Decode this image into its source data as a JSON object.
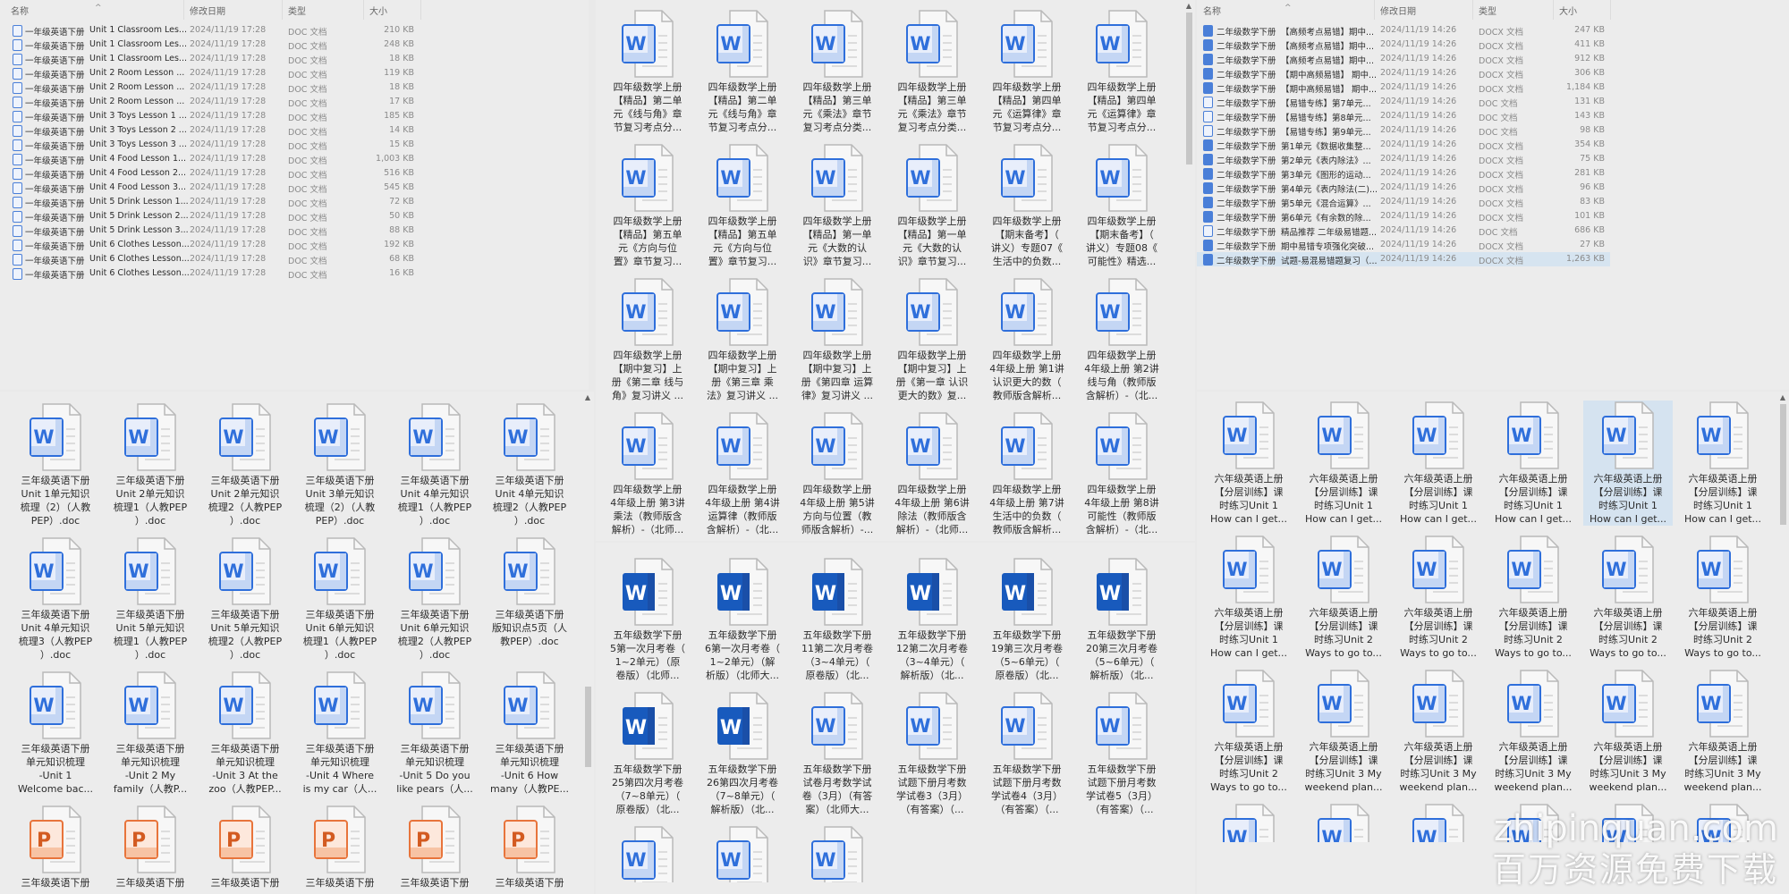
{
  "list_headers": {
    "name": "名称",
    "date": "修改日期",
    "type": "类型",
    "size": "大小"
  },
  "left_list": [
    {
      "prefix": "一年级英语下册",
      "name": "Unit 1 Classroom Les...",
      "date": "2024/11/19 17:28",
      "type": "DOC 文档",
      "size": "210 KB",
      "icon": "doc"
    },
    {
      "prefix": "一年级英语下册",
      "name": "Unit 1 Classroom Les...",
      "date": "2024/11/19 17:28",
      "type": "DOC 文档",
      "size": "248 KB",
      "icon": "doc"
    },
    {
      "prefix": "一年级英语下册",
      "name": "Unit 1 Classroom Les...",
      "date": "2024/11/19 17:28",
      "type": "DOC 文档",
      "size": "18 KB",
      "icon": "doc"
    },
    {
      "prefix": "一年级英语下册",
      "name": "Unit 2 Room Lesson ...",
      "date": "2024/11/19 17:28",
      "type": "DOC 文档",
      "size": "119 KB",
      "icon": "doc"
    },
    {
      "prefix": "一年级英语下册",
      "name": "Unit 2 Room Lesson ...",
      "date": "2024/11/19 17:28",
      "type": "DOC 文档",
      "size": "18 KB",
      "icon": "doc"
    },
    {
      "prefix": "一年级英语下册",
      "name": "Unit 2 Room Lesson ...",
      "date": "2024/11/19 17:28",
      "type": "DOC 文档",
      "size": "17 KB",
      "icon": "doc"
    },
    {
      "prefix": "一年级英语下册",
      "name": "Unit 3 Toys Lesson 1 ...",
      "date": "2024/11/19 17:28",
      "type": "DOC 文档",
      "size": "185 KB",
      "icon": "doc"
    },
    {
      "prefix": "一年级英语下册",
      "name": "Unit 3 Toys Lesson 2 ...",
      "date": "2024/11/19 17:28",
      "type": "DOC 文档",
      "size": "14 KB",
      "icon": "doc"
    },
    {
      "prefix": "一年级英语下册",
      "name": "Unit 3 Toys Lesson 3 ...",
      "date": "2024/11/19 17:28",
      "type": "DOC 文档",
      "size": "15 KB",
      "icon": "doc"
    },
    {
      "prefix": "一年级英语下册",
      "name": "Unit 4 Food Lesson 1...",
      "date": "2024/11/19 17:28",
      "type": "DOC 文档",
      "size": "1,003 KB",
      "icon": "doc"
    },
    {
      "prefix": "一年级英语下册",
      "name": "Unit 4 Food Lesson 2...",
      "date": "2024/11/19 17:28",
      "type": "DOC 文档",
      "size": "516 KB",
      "icon": "doc"
    },
    {
      "prefix": "一年级英语下册",
      "name": "Unit 4 Food Lesson 3...",
      "date": "2024/11/19 17:28",
      "type": "DOC 文档",
      "size": "545 KB",
      "icon": "doc"
    },
    {
      "prefix": "一年级英语下册",
      "name": "Unit 5 Drink Lesson 1...",
      "date": "2024/11/19 17:28",
      "type": "DOC 文档",
      "size": "72 KB",
      "icon": "doc"
    },
    {
      "prefix": "一年级英语下册",
      "name": "Unit 5 Drink Lesson 2...",
      "date": "2024/11/19 17:28",
      "type": "DOC 文档",
      "size": "50 KB",
      "icon": "doc"
    },
    {
      "prefix": "一年级英语下册",
      "name": "Unit 5 Drink Lesson 3...",
      "date": "2024/11/19 17:28",
      "type": "DOC 文档",
      "size": "88 KB",
      "icon": "doc"
    },
    {
      "prefix": "一年级英语下册",
      "name": "Unit 6 Clothes Lesson...",
      "date": "2024/11/19 17:28",
      "type": "DOC 文档",
      "size": "192 KB",
      "icon": "doc"
    },
    {
      "prefix": "一年级英语下册",
      "name": "Unit 6 Clothes Lesson...",
      "date": "2024/11/19 17:28",
      "type": "DOC 文档",
      "size": "68 KB",
      "icon": "doc"
    },
    {
      "prefix": "一年级英语下册",
      "name": "Unit 6 Clothes Lesson...",
      "date": "2024/11/19 17:28",
      "type": "DOC 文档",
      "size": "16 KB",
      "icon": "doc"
    }
  ],
  "right_list": [
    {
      "prefix": "二年级数学下册",
      "name": "【高频考点易错】期中...",
      "date": "2024/11/19 14:26",
      "type": "DOCX 文档",
      "size": "247 KB",
      "icon": "docx"
    },
    {
      "prefix": "二年级数学下册",
      "name": "【高频考点易错】期中...",
      "date": "2024/11/19 14:26",
      "type": "DOCX 文档",
      "size": "411 KB",
      "icon": "docx"
    },
    {
      "prefix": "二年级数学下册",
      "name": "【高频考点易错】期中...",
      "date": "2024/11/19 14:26",
      "type": "DOCX 文档",
      "size": "912 KB",
      "icon": "docx"
    },
    {
      "prefix": "二年级数学下册",
      "name": "【期中高频易错】 期中...",
      "date": "2024/11/19 14:26",
      "type": "DOCX 文档",
      "size": "306 KB",
      "icon": "docx"
    },
    {
      "prefix": "二年级数学下册",
      "name": "【期中高频易错】 期中...",
      "date": "2024/11/19 14:26",
      "type": "DOCX 文档",
      "size": "1,184 KB",
      "icon": "docx"
    },
    {
      "prefix": "二年级数学下册",
      "name": "【易错专练】第7单元...",
      "date": "2024/11/19 14:26",
      "type": "DOC 文档",
      "size": "131 KB",
      "icon": "doc"
    },
    {
      "prefix": "二年级数学下册",
      "name": "【易错专练】第8单元...",
      "date": "2024/11/19 14:26",
      "type": "DOC 文档",
      "size": "143 KB",
      "icon": "doc"
    },
    {
      "prefix": "二年级数学下册",
      "name": "【易错专练】第9单元...",
      "date": "2024/11/19 14:26",
      "type": "DOC 文档",
      "size": "98 KB",
      "icon": "doc"
    },
    {
      "prefix": "二年级数学下册",
      "name": "第1单元《数据收集整...",
      "date": "2024/11/19 14:26",
      "type": "DOCX 文档",
      "size": "354 KB",
      "icon": "docx"
    },
    {
      "prefix": "二年级数学下册",
      "name": "第2单元《表内除法》...",
      "date": "2024/11/19 14:26",
      "type": "DOCX 文档",
      "size": "75 KB",
      "icon": "docx"
    },
    {
      "prefix": "二年级数学下册",
      "name": "第3单元《图形的运动...",
      "date": "2024/11/19 14:26",
      "type": "DOCX 文档",
      "size": "281 KB",
      "icon": "docx"
    },
    {
      "prefix": "二年级数学下册",
      "name": "第4单元《表内除法(二)...",
      "date": "2024/11/19 14:26",
      "type": "DOCX 文档",
      "size": "96 KB",
      "icon": "docx"
    },
    {
      "prefix": "二年级数学下册",
      "name": "第5单元《混合运算》...",
      "date": "2024/11/19 14:26",
      "type": "DOCX 文档",
      "size": "83 KB",
      "icon": "docx"
    },
    {
      "prefix": "二年级数学下册",
      "name": "第6单元《有余数的除...",
      "date": "2024/11/19 14:26",
      "type": "DOCX 文档",
      "size": "101 KB",
      "icon": "docx"
    },
    {
      "prefix": "二年级数学下册",
      "name": "精品推荐 二年级易错题...",
      "date": "2024/11/19 14:26",
      "type": "DOC 文档",
      "size": "686 KB",
      "icon": "doc"
    },
    {
      "prefix": "二年级数学下册",
      "name": "期中易错专项强化突破...",
      "date": "2024/11/19 14:26",
      "type": "DOCX 文档",
      "size": "27 KB",
      "icon": "docx"
    },
    {
      "prefix": "二年级数学下册",
      "name": "试题-易混易错题复习（...",
      "date": "2024/11/19 14:26",
      "type": "DOCX 文档",
      "size": "1,263 KB",
      "icon": "docx",
      "selected": true
    }
  ],
  "left_grid": [
    {
      "icon": "word",
      "label": "三年级英语下册\nUnit 1单元知识\n梳理（2）（人教\nPEP）.doc"
    },
    {
      "icon": "word",
      "label": "三年级英语下册\nUnit 2单元知识\n梳理1（人教PEP\n）.doc"
    },
    {
      "icon": "word",
      "label": "三年级英语下册\nUnit 2单元知识\n梳理2（人教PEP\n）.doc"
    },
    {
      "icon": "word",
      "label": "三年级英语下册\nUnit 3单元知识\n梳理（2）（人教\nPEP）.doc"
    },
    {
      "icon": "word",
      "label": "三年级英语下册\nUnit 4单元知识\n梳理1（人教PEP\n）.doc"
    },
    {
      "icon": "word",
      "label": "三年级英语下册\nUnit 4单元知识\n梳理2（人教PEP\n）.doc"
    },
    {
      "icon": "word",
      "label": "三年级英语下册\nUnit 4单元知识\n梳理3（人教PEP\n）.doc"
    },
    {
      "icon": "word",
      "label": "三年级英语下册\nUnit 5单元知识\n梳理1（人教PEP\n）.doc"
    },
    {
      "icon": "word",
      "label": "三年级英语下册\nUnit 5单元知识\n梳理2（人教PEP\n）.doc"
    },
    {
      "icon": "word",
      "label": "三年级英语下册\nUnit 6单元知识\n梳理1（人教PEP\n）.doc"
    },
    {
      "icon": "word",
      "label": "三年级英语下册\nUnit 6单元知识\n梳理2（人教PEP\n）.doc"
    },
    {
      "icon": "word",
      "label": "三年级英语下册\n版知识点5页（人\n教PEP）.doc"
    },
    {
      "icon": "word",
      "label": "三年级英语下册\n单元知识梳理\n-Unit 1\nWelcome bac..."
    },
    {
      "icon": "word",
      "label": "三年级英语下册\n单元知识梳理\n-Unit 2 My\nfamily（人教P..."
    },
    {
      "icon": "word",
      "label": "三年级英语下册\n单元知识梳理\n-Unit 3 At the\nzoo（人教PEP..."
    },
    {
      "icon": "word",
      "label": "三年级英语下册\n单元知识梳理\n-Unit 4 Where\nis my car（人..."
    },
    {
      "icon": "word",
      "label": "三年级英语下册\n单元知识梳理\n-Unit 5 Do you\nlike pears（人..."
    },
    {
      "icon": "word",
      "label": "三年级英语下册\n单元知识梳理\n-Unit 6 How\nmany（人教PE..."
    },
    {
      "icon": "ppt",
      "label": "三年级英语下册"
    },
    {
      "icon": "ppt",
      "label": "三年级英语下册"
    },
    {
      "icon": "ppt",
      "label": "三年级英语下册"
    },
    {
      "icon": "ppt",
      "label": "三年级英语下册"
    },
    {
      "icon": "ppt",
      "label": "三年级英语下册"
    },
    {
      "icon": "ppt",
      "label": "三年级英语下册"
    }
  ],
  "middle_top_grid": [
    {
      "icon": "word",
      "label": "四年级数学上册\n【精品】第二单\n元《线与角》章\n节复习考点分..."
    },
    {
      "icon": "word",
      "label": "四年级数学上册\n【精品】第二单\n元《线与角》章\n节复习考点分..."
    },
    {
      "icon": "word",
      "label": "四年级数学上册\n【精品】第三单\n元《乘法》章节\n复习考点分类..."
    },
    {
      "icon": "word",
      "label": "四年级数学上册\n【精品】第三单\n元《乘法》章节\n复习考点分类..."
    },
    {
      "icon": "word",
      "label": "四年级数学上册\n【精品】第四单\n元《运算律》章\n节复习考点分..."
    },
    {
      "icon": "word",
      "label": "四年级数学上册\n【精品】第四单\n元《运算律》章\n节复习考点分..."
    },
    {
      "icon": "word",
      "label": "四年级数学上册\n【精品】第五单\n元《方向与位\n置》章节复习..."
    },
    {
      "icon": "word",
      "label": "四年级数学上册\n【精品】第五单\n元《方向与位\n置》章节复习..."
    },
    {
      "icon": "word",
      "label": "四年级数学上册\n【精品】第一单\n元《大数的认\n识》章节复习..."
    },
    {
      "icon": "word",
      "label": "四年级数学上册\n【精品】第一单\n元《大数的认\n识》章节复习..."
    },
    {
      "icon": "word",
      "label": "四年级数学上册\n【期末备考】（\n讲义）专题07《\n生活中的负数..."
    },
    {
      "icon": "word",
      "label": "四年级数学上册\n【期末备考】（\n讲义）专题08《\n可能性》精选..."
    },
    {
      "icon": "word",
      "label": "四年级数学上册\n【期中复习】上\n册《第二章 线与\n角》复习讲义 ..."
    },
    {
      "icon": "word",
      "label": "四年级数学上册\n【期中复习】上\n册《第三章 乘\n法》复习讲义 ..."
    },
    {
      "icon": "word",
      "label": "四年级数学上册\n【期中复习】上\n册《第四章 运算\n律》复习讲义 ..."
    },
    {
      "icon": "word",
      "label": "四年级数学上册\n【期中复习】上\n册《第一章 认识\n更大的数》复..."
    },
    {
      "icon": "word",
      "label": "四年级数学上册\n4年级上册 第1讲\n认识更大的数（\n教师版含解析..."
    },
    {
      "icon": "word",
      "label": "四年级数学上册\n4年级上册 第2讲\n线与角（教师版\n含解析）-（北..."
    },
    {
      "icon": "word",
      "label": "四年级数学上册\n4年级上册 第3讲\n乘法（教师版含\n解析）-（北师..."
    },
    {
      "icon": "word",
      "label": "四年级数学上册\n4年级上册 第4讲\n运算律（教师版\n含解析）-（北..."
    },
    {
      "icon": "word",
      "label": "四年级数学上册\n4年级上册 第5讲\n方向与位置（教\n师版含解析）-..."
    },
    {
      "icon": "word",
      "label": "四年级数学上册\n4年级上册 第6讲\n除法（教师版含\n解析）-（北师..."
    },
    {
      "icon": "word",
      "label": "四年级数学上册\n4年级上册 第7讲\n生活中的负数（\n教师版含解析..."
    },
    {
      "icon": "word",
      "label": "四年级数学上册\n4年级上册 第8讲\n可能性（教师版\n含解析）-（北..."
    }
  ],
  "middle_bottom_grid": [
    {
      "icon": "word-filled",
      "label": "五年级数学下册\n5第一次月考卷（\n1~2单元）（原\n卷版）（北师..."
    },
    {
      "icon": "word-filled",
      "label": "五年级数学下册\n6第一次月考卷（\n1~2单元）（解\n析版）（北师大..."
    },
    {
      "icon": "word-filled",
      "label": "五年级数学下册\n11第二次月考卷\n（3~4单元）（\n原卷版）（北..."
    },
    {
      "icon": "word-filled",
      "label": "五年级数学下册\n12第二次月考卷\n（3~4单元）（\n解析版）（北..."
    },
    {
      "icon": "word-filled",
      "label": "五年级数学下册\n19第三次月考卷\n（5~6单元）（\n原卷版）（北..."
    },
    {
      "icon": "word-filled",
      "label": "五年级数学下册\n20第三次月考卷\n（5~6单元）（\n解析版）（北..."
    },
    {
      "icon": "word-filled",
      "label": "五年级数学下册\n25第四次月考卷\n（7~8单元）（\n原卷版）（北..."
    },
    {
      "icon": "word-filled",
      "label": "五年级数学下册\n26第四次月考卷\n（7~8单元）（\n解析版）（北..."
    },
    {
      "icon": "word",
      "label": "五年级数学下册\n试卷月考数学试\n卷（3月）（有答\n案）（北师大..."
    },
    {
      "icon": "word",
      "label": "五年级数学下册\n试题下册月考数\n学试卷3（3月）\n（有答案）（..."
    },
    {
      "icon": "word",
      "label": "五年级数学下册\n试题下册月考数\n学试卷4（3月）\n（有答案）（..."
    },
    {
      "icon": "word",
      "label": "五年级数学下册\n试题下册月考数\n学试卷5（3月）\n（有答案）（..."
    },
    {
      "icon": "word",
      "label": ""
    },
    {
      "icon": "word",
      "label": ""
    },
    {
      "icon": "word",
      "label": ""
    }
  ],
  "right_grid": [
    {
      "icon": "word",
      "label": "六年级英语上册\n【分层训练】课\n时练习Unit 1\nHow can I get..."
    },
    {
      "icon": "word",
      "label": "六年级英语上册\n【分层训练】课\n时练习Unit 1\nHow can I get..."
    },
    {
      "icon": "word",
      "label": "六年级英语上册\n【分层训练】课\n时练习Unit 1\nHow can I get..."
    },
    {
      "icon": "word",
      "label": "六年级英语上册\n【分层训练】课\n时练习Unit 1\nHow can I get..."
    },
    {
      "icon": "word",
      "label": "六年级英语上册\n【分层训练】课\n时练习Unit 1\nHow can I get...",
      "selected": true
    },
    {
      "icon": "word",
      "label": "六年级英语上册\n【分层训练】课\n时练习Unit 1\nHow can I get..."
    },
    {
      "icon": "word",
      "label": "六年级英语上册\n【分层训练】课\n时练习Unit 1\nHow can I get..."
    },
    {
      "icon": "word",
      "label": "六年级英语上册\n【分层训练】课\n时练习Unit 2\nWays to go to..."
    },
    {
      "icon": "word",
      "label": "六年级英语上册\n【分层训练】课\n时练习Unit 2\nWays to go to..."
    },
    {
      "icon": "word",
      "label": "六年级英语上册\n【分层训练】课\n时练习Unit 2\nWays to go to..."
    },
    {
      "icon": "word",
      "label": "六年级英语上册\n【分层训练】课\n时练习Unit 2\nWays to go to..."
    },
    {
      "icon": "word",
      "label": "六年级英语上册\n【分层训练】课\n时练习Unit 2\nWays to go to..."
    },
    {
      "icon": "word",
      "label": "六年级英语上册\n【分层训练】课\n时练习Unit 2\nWays to go to..."
    },
    {
      "icon": "word",
      "label": "六年级英语上册\n【分层训练】课\n时练习Unit 3 My\nweekend plan..."
    },
    {
      "icon": "word",
      "label": "六年级英语上册\n【分层训练】课\n时练习Unit 3 My\nweekend plan..."
    },
    {
      "icon": "word",
      "label": "六年级英语上册\n【分层训练】课\n时练习Unit 3 My\nweekend plan..."
    },
    {
      "icon": "word",
      "label": "六年级英语上册\n【分层训练】课\n时练习Unit 3 My\nweekend plan..."
    },
    {
      "icon": "word",
      "label": "六年级英语上册\n【分层训练】课\n时练习Unit 3 My\nweekend plan..."
    },
    {
      "icon": "word",
      "label": ""
    },
    {
      "icon": "word",
      "label": ""
    },
    {
      "icon": "word",
      "label": ""
    },
    {
      "icon": "word",
      "label": ""
    },
    {
      "icon": "word",
      "label": ""
    },
    {
      "icon": "word",
      "label": ""
    }
  ],
  "watermark": {
    "line1": "zhipinquan.com",
    "line2": "百万资源免费下载"
  },
  "colors": {
    "word_blue": "#2f6fdb",
    "word_filled": "#185abd",
    "ppt_orange": "#e8743b",
    "selection": "#d5e3f0"
  }
}
